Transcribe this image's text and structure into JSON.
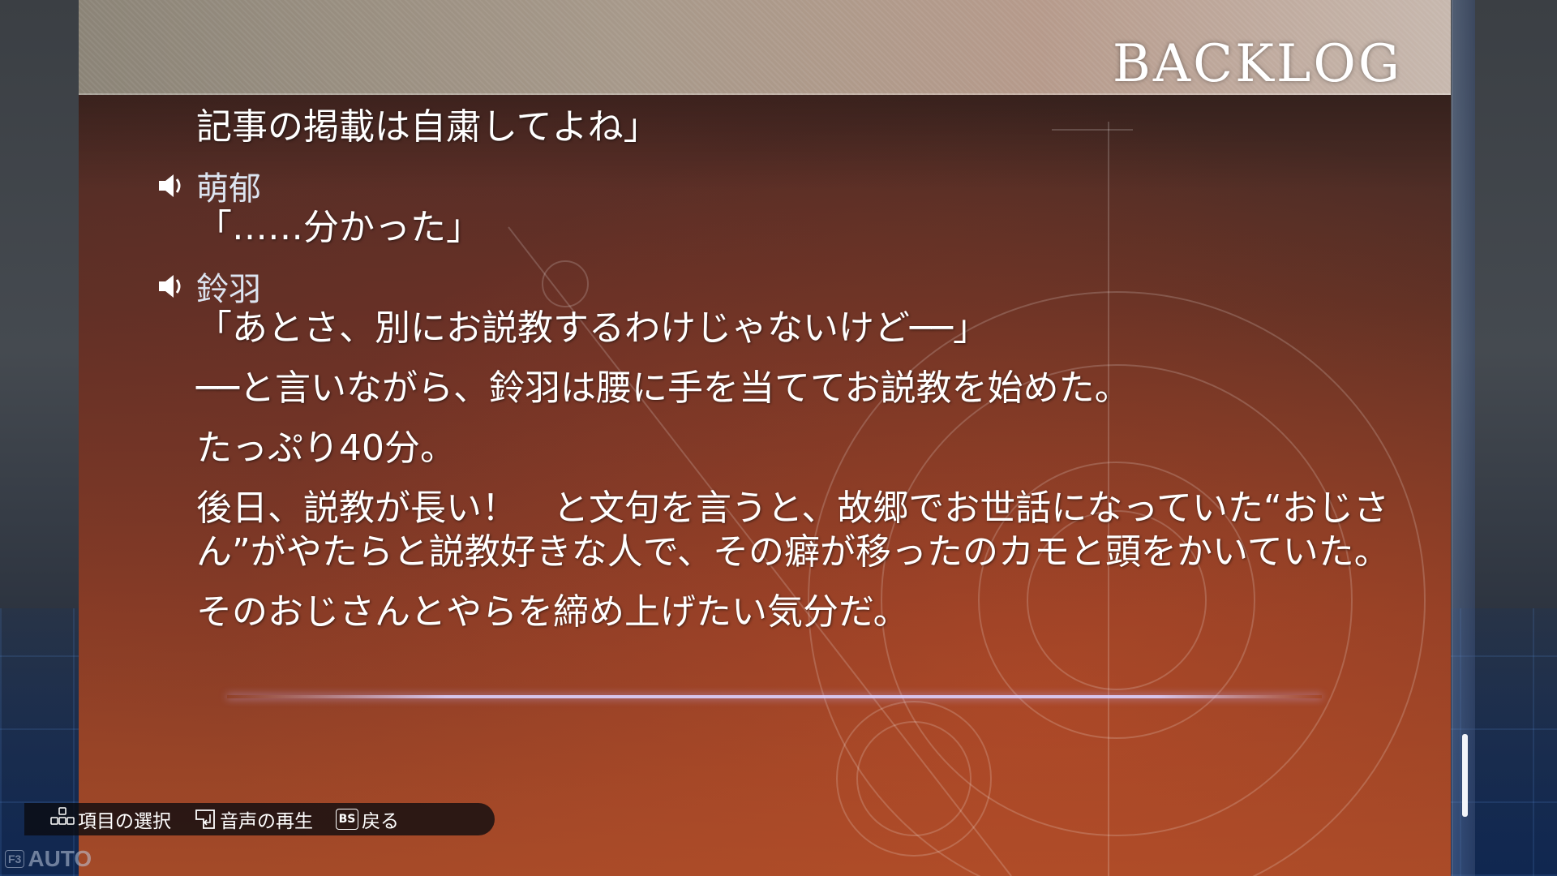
{
  "header": {
    "title": "BACKLOG"
  },
  "log": {
    "entries": [
      {
        "speaker": "",
        "text": "記事の掲載は自粛してよね」"
      },
      {
        "speaker": "萌郁",
        "text": "「……分かった」"
      },
      {
        "speaker": "鈴羽",
        "text": "「あとさ、別にお説教するわけじゃないけど──」"
      },
      {
        "speaker": "",
        "text": "──と言いながら、鈴羽は腰に手を当ててお説教を始めた。"
      },
      {
        "speaker": "",
        "text": "たっぷり40分。"
      },
      {
        "speaker": "",
        "text": "後日、説教が長い！　と文句を言うと、故郷でお世話になっていた“おじさん”がやたらと説教好きな人で、その癖が移ったのカモと頭をかいていた。"
      },
      {
        "speaker": "",
        "text": "そのおじさんとやらを締め上げたい気分だ。"
      }
    ]
  },
  "footer": {
    "select_label": "項目の選択",
    "play_voice_label": "音声の再生",
    "back_key": "BS",
    "back_label": "戻る"
  },
  "auto": {
    "key": "F3",
    "label": "AUTO"
  },
  "colors": {
    "accent": "#e0d8ff",
    "panel": "#8a3d26",
    "footer_bg": "#0a0a0f"
  }
}
